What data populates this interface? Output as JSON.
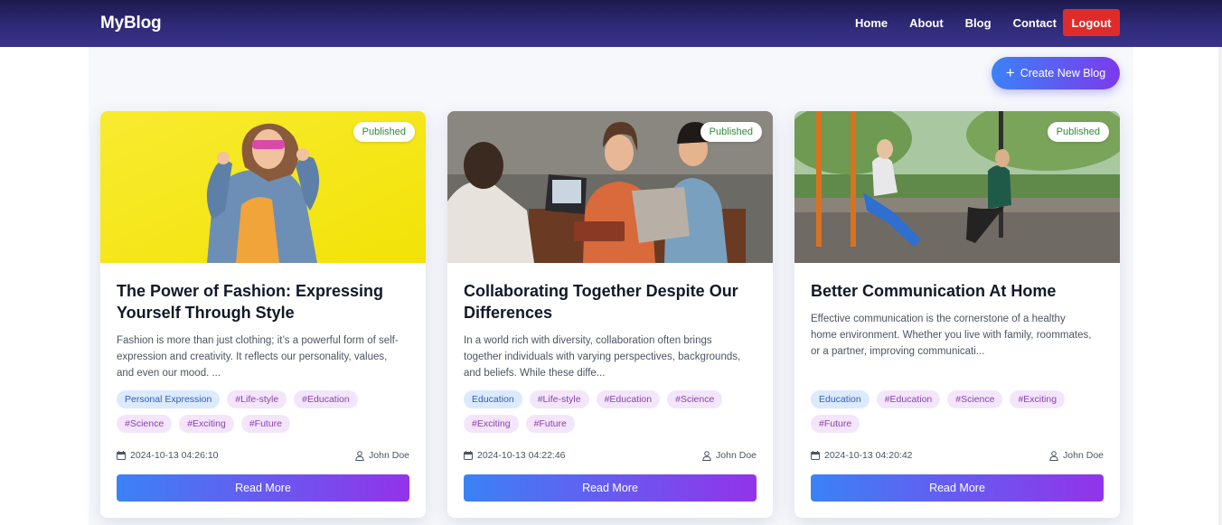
{
  "navbar": {
    "brand": "MyBlog",
    "links": [
      "Home",
      "About",
      "Blog",
      "Contact"
    ],
    "logout_label": "Logout",
    "logout_color": "#e02b2b"
  },
  "toolbar": {
    "create_label": "Create New Blog",
    "create_icon": "plus-icon"
  },
  "posts": [
    {
      "status": "Published",
      "image": "woman-in-denim-jacket-yellow-wall-photo",
      "title": "The Power of Fashion: Expressing Yourself Through Style",
      "excerpt": "Fashion is more than just clothing; it’s a powerful form of self-expression and creativity. It reflects our personality, values, and even our mood. ...",
      "category": "Personal Expression",
      "tags": [
        "#Life-style",
        "#Education",
        "#Science",
        "#Exciting",
        "#Future"
      ],
      "date": "2024-10-13 04:26:10",
      "author": "John Doe",
      "read_more": "Read More"
    },
    {
      "status": "Published",
      "image": "friends-collaborating-with-laptops-photo",
      "title": "Collaborating Together Despite Our Differences",
      "excerpt": "In a world rich with diversity, collaboration often brings together individuals with varying perspectives, backgrounds, and beliefs. While these diffe...",
      "category": "Education",
      "tags": [
        "#Life-style",
        "#Education",
        "#Science",
        "#Exciting",
        "#Future"
      ],
      "date": "2024-10-13 04:22:46",
      "author": "John Doe",
      "read_more": "Read More"
    },
    {
      "status": "Published",
      "image": "two-women-on-park-swings-photo",
      "title": "Better Communication At Home",
      "excerpt": "Effective communication is the cornerstone of a healthy home environment. Whether you live with family, roommates, or a partner, improving communicati...",
      "category": "Education",
      "tags": [
        "#Education",
        "#Science",
        "#Exciting",
        "#Future"
      ],
      "date": "2024-10-13 04:20:42",
      "author": "John Doe",
      "read_more": "Read More"
    }
  ]
}
